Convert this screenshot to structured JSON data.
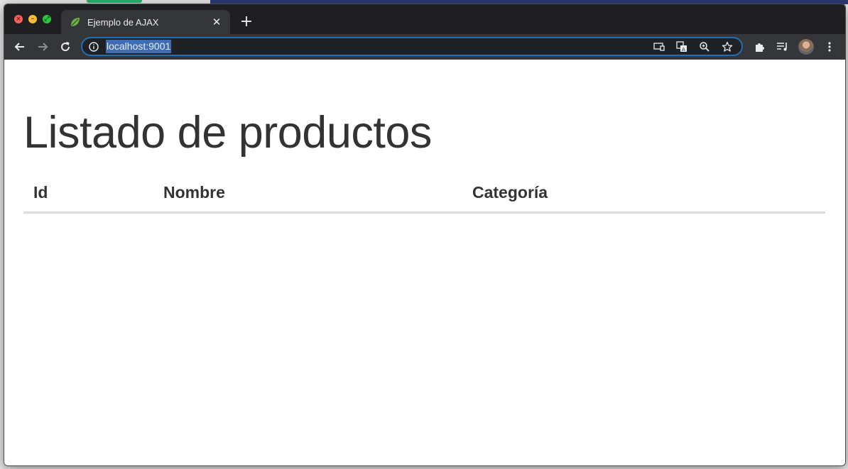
{
  "browser": {
    "tab": {
      "title": "Ejemplo de AJAX",
      "favicon": "spring-leaf-icon"
    },
    "address_bar": {
      "url": "localhost:9001"
    },
    "colors": {
      "tabstrip": "#1f1f21",
      "toolbar": "#35363a",
      "omnibox_focus": "#1f6fb3",
      "url_selection": "#3f6db3"
    }
  },
  "page": {
    "title": "Listado de productos",
    "table": {
      "headers": [
        "Id",
        "Nombre",
        "Categoría"
      ],
      "rows": []
    }
  }
}
